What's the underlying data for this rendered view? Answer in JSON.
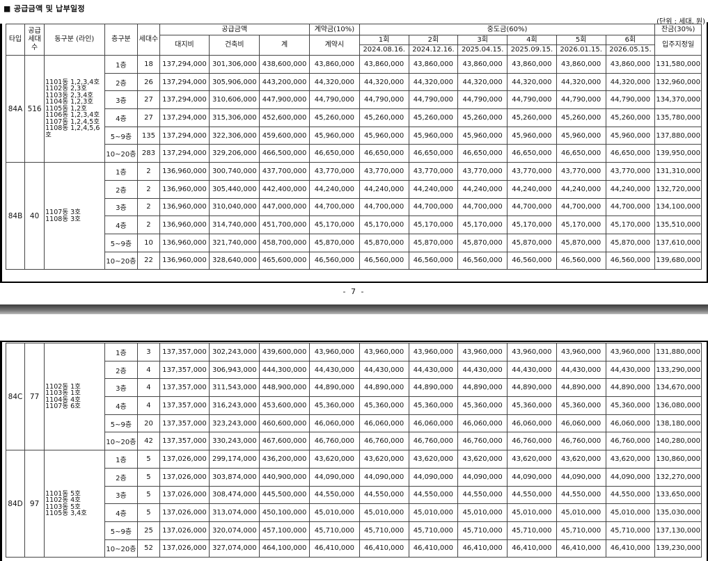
{
  "title": "■ 공급금액 및 납부일정",
  "unit": "(단위 : 세대, 원)",
  "page_number": "- 7 -",
  "header": {
    "type": "타입",
    "supply": "공급 세대수",
    "dong": "동구분 (라인)",
    "floor": "층구분",
    "households": "세대수",
    "price_group": "공급금액",
    "land": "대지비",
    "building": "건축비",
    "total": "계",
    "deposit_group": "계약금(10%)",
    "deposit_time": "계약시",
    "middle_group": "중도금(60%)",
    "middle": [
      {
        "label": "1회",
        "date": "2024.08.16."
      },
      {
        "label": "2회",
        "date": "2024.12.16."
      },
      {
        "label": "3회",
        "date": "2025.04.15."
      },
      {
        "label": "4회",
        "date": "2025.09.15."
      },
      {
        "label": "5회",
        "date": "2026.01.15."
      },
      {
        "label": "6회",
        "date": "2026.05.15."
      }
    ],
    "balance_group": "잔금(30%)",
    "balance_time": "입주지정일"
  },
  "groups_page1": [
    {
      "type": "84A",
      "supply": "516",
      "dong": [
        "1101동 1,2,3,4호",
        "1102동 2,3호",
        "1103동 2,3,4호",
        "1104동 1,2,3호",
        "1105동 1,2호",
        "1106동 1,2,3,4호",
        "1107동 1,2,4,5호",
        "1108동 1,2,4,5,6호"
      ],
      "rows": [
        {
          "floor": "1층",
          "hh": "18",
          "land": "137,294,000",
          "build": "301,306,000",
          "total": "438,600,000",
          "dep": "43,860,000",
          "m": "43,860,000",
          "bal": "131,580,000"
        },
        {
          "floor": "2층",
          "hh": "26",
          "land": "137,294,000",
          "build": "305,906,000",
          "total": "443,200,000",
          "dep": "44,320,000",
          "m": "44,320,000",
          "bal": "132,960,000"
        },
        {
          "floor": "3층",
          "hh": "27",
          "land": "137,294,000",
          "build": "310,606,000",
          "total": "447,900,000",
          "dep": "44,790,000",
          "m": "44,790,000",
          "bal": "134,370,000"
        },
        {
          "floor": "4층",
          "hh": "27",
          "land": "137,294,000",
          "build": "315,306,000",
          "total": "452,600,000",
          "dep": "45,260,000",
          "m": "45,260,000",
          "bal": "135,780,000"
        },
        {
          "floor": "5~9층",
          "hh": "135",
          "land": "137,294,000",
          "build": "322,306,000",
          "total": "459,600,000",
          "dep": "45,960,000",
          "m": "45,960,000",
          "bal": "137,880,000"
        },
        {
          "floor": "10~20층",
          "hh": "283",
          "land": "137,294,000",
          "build": "329,206,000",
          "total": "466,500,000",
          "dep": "46,650,000",
          "m": "46,650,000",
          "bal": "139,950,000"
        }
      ]
    },
    {
      "type": "84B",
      "supply": "40",
      "dong": [
        "1107동 3호",
        "1108동 3호"
      ],
      "rows": [
        {
          "floor": "1층",
          "hh": "2",
          "land": "136,960,000",
          "build": "300,740,000",
          "total": "437,700,000",
          "dep": "43,770,000",
          "m": "43,770,000",
          "bal": "131,310,000"
        },
        {
          "floor": "2층",
          "hh": "2",
          "land": "136,960,000",
          "build": "305,440,000",
          "total": "442,400,000",
          "dep": "44,240,000",
          "m": "44,240,000",
          "bal": "132,720,000"
        },
        {
          "floor": "3층",
          "hh": "2",
          "land": "136,960,000",
          "build": "310,040,000",
          "total": "447,000,000",
          "dep": "44,700,000",
          "m": "44,700,000",
          "bal": "134,100,000"
        },
        {
          "floor": "4층",
          "hh": "2",
          "land": "136,960,000",
          "build": "314,740,000",
          "total": "451,700,000",
          "dep": "45,170,000",
          "m": "45,170,000",
          "bal": "135,510,000"
        },
        {
          "floor": "5~9층",
          "hh": "10",
          "land": "136,960,000",
          "build": "321,740,000",
          "total": "458,700,000",
          "dep": "45,870,000",
          "m": "45,870,000",
          "bal": "137,610,000"
        },
        {
          "floor": "10~20층",
          "hh": "22",
          "land": "136,960,000",
          "build": "328,640,000",
          "total": "465,600,000",
          "dep": "46,560,000",
          "m": "46,560,000",
          "bal": "139,680,000"
        }
      ]
    }
  ],
  "groups_page2": [
    {
      "type": "84C",
      "supply": "77",
      "dong": [
        "1102동 1호",
        "1103동 1호",
        "1104동 4호",
        "1107동 6호"
      ],
      "rows": [
        {
          "floor": "1층",
          "hh": "3",
          "land": "137,357,000",
          "build": "302,243,000",
          "total": "439,600,000",
          "dep": "43,960,000",
          "m": "43,960,000",
          "bal": "131,880,000"
        },
        {
          "floor": "2층",
          "hh": "4",
          "land": "137,357,000",
          "build": "306,943,000",
          "total": "444,300,000",
          "dep": "44,430,000",
          "m": "44,430,000",
          "bal": "133,290,000"
        },
        {
          "floor": "3층",
          "hh": "4",
          "land": "137,357,000",
          "build": "311,543,000",
          "total": "448,900,000",
          "dep": "44,890,000",
          "m": "44,890,000",
          "bal": "134,670,000"
        },
        {
          "floor": "4층",
          "hh": "4",
          "land": "137,357,000",
          "build": "316,243,000",
          "total": "453,600,000",
          "dep": "45,360,000",
          "m": "45,360,000",
          "bal": "136,080,000"
        },
        {
          "floor": "5~9층",
          "hh": "20",
          "land": "137,357,000",
          "build": "323,243,000",
          "total": "460,600,000",
          "dep": "46,060,000",
          "m": "46,060,000",
          "bal": "138,180,000"
        },
        {
          "floor": "10~20층",
          "hh": "42",
          "land": "137,357,000",
          "build": "330,243,000",
          "total": "467,600,000",
          "dep": "46,760,000",
          "m": "46,760,000",
          "bal": "140,280,000"
        }
      ]
    },
    {
      "type": "84D",
      "supply": "97",
      "dong": [
        "1101동 5호",
        "1102동 4호",
        "1103동 5호",
        "1105동 3,4호"
      ],
      "rows": [
        {
          "floor": "1층",
          "hh": "5",
          "land": "137,026,000",
          "build": "299,174,000",
          "total": "436,200,000",
          "dep": "43,620,000",
          "m": "43,620,000",
          "bal": "130,860,000"
        },
        {
          "floor": "2층",
          "hh": "5",
          "land": "137,026,000",
          "build": "303,874,000",
          "total": "440,900,000",
          "dep": "44,090,000",
          "m": "44,090,000",
          "bal": "132,270,000"
        },
        {
          "floor": "3층",
          "hh": "5",
          "land": "137,026,000",
          "build": "308,474,000",
          "total": "445,500,000",
          "dep": "44,550,000",
          "m": "44,550,000",
          "bal": "133,650,000"
        },
        {
          "floor": "4층",
          "hh": "5",
          "land": "137,026,000",
          "build": "313,074,000",
          "total": "450,100,000",
          "dep": "45,010,000",
          "m": "45,010,000",
          "bal": "135,030,000"
        },
        {
          "floor": "5~9층",
          "hh": "25",
          "land": "137,026,000",
          "build": "320,074,000",
          "total": "457,100,000",
          "dep": "45,710,000",
          "m": "45,710,000",
          "bal": "137,130,000"
        },
        {
          "floor": "10~20층",
          "hh": "52",
          "land": "137,026,000",
          "build": "327,074,000",
          "total": "464,100,000",
          "dep": "46,410,000",
          "m": "46,410,000",
          "bal": "139,230,000"
        }
      ]
    }
  ]
}
